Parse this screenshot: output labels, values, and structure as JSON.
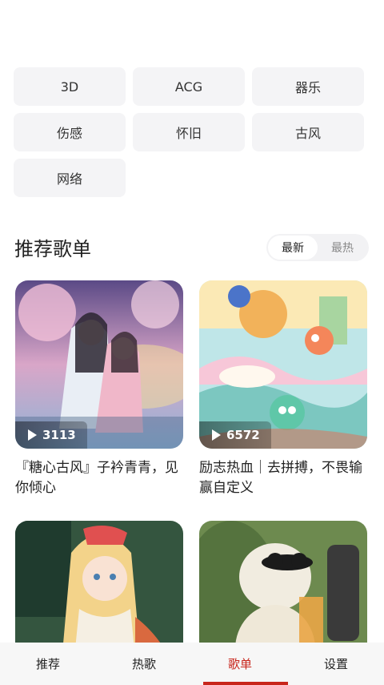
{
  "tags": [
    "3D",
    "ACG",
    "器乐",
    "伤感",
    "怀旧",
    "古风",
    "网络"
  ],
  "section": {
    "title": "推荐歌单",
    "sort_options": [
      "最新",
      "最热"
    ],
    "active_sort": "最新"
  },
  "playlists": [
    {
      "title": "『糖心古风』子衿青青，见你倾心",
      "play_count": "3113"
    },
    {
      "title": "励志热血｜去拼搏，不畏输赢自定义",
      "play_count": "6572"
    },
    {
      "title": "",
      "play_count": ""
    },
    {
      "title": "",
      "play_count": ""
    }
  ],
  "tabbar": {
    "items": [
      "推荐",
      "热歌",
      "歌单",
      "设置"
    ],
    "active": "歌单"
  },
  "colors": {
    "accent": "#c8261c",
    "tag_bg": "#f4f4f6",
    "tabbar_bg": "#f7f7f7"
  }
}
